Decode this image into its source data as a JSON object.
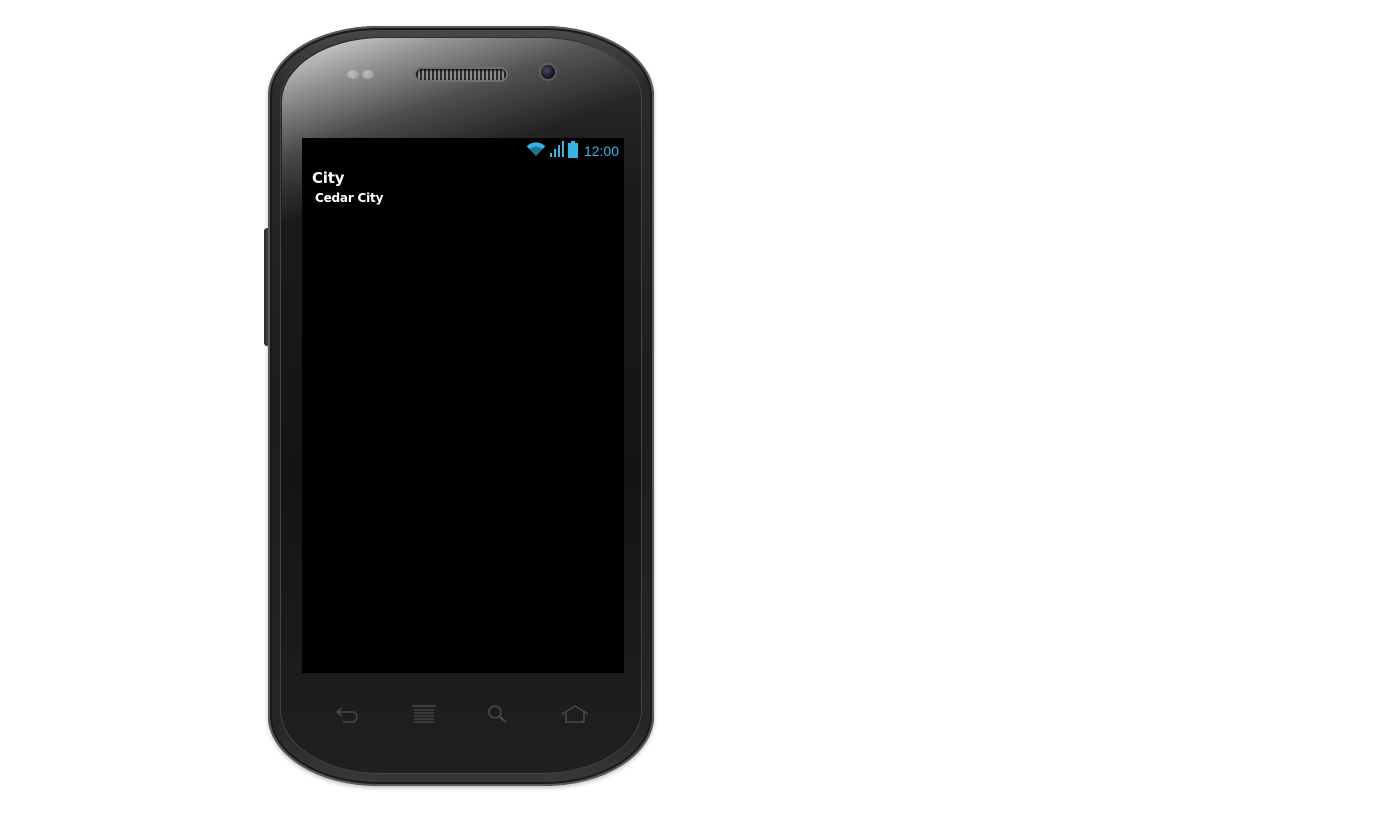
{
  "status_bar": {
    "time": "12:00",
    "accent_color": "#33b5e5",
    "icons": [
      "wifi-icon",
      "signal-icon",
      "battery-icon"
    ]
  },
  "content": {
    "label": "City",
    "value": "Cedar City"
  },
  "soft_keys": [
    "back-icon",
    "menu-icon",
    "search-icon",
    "home-icon"
  ]
}
